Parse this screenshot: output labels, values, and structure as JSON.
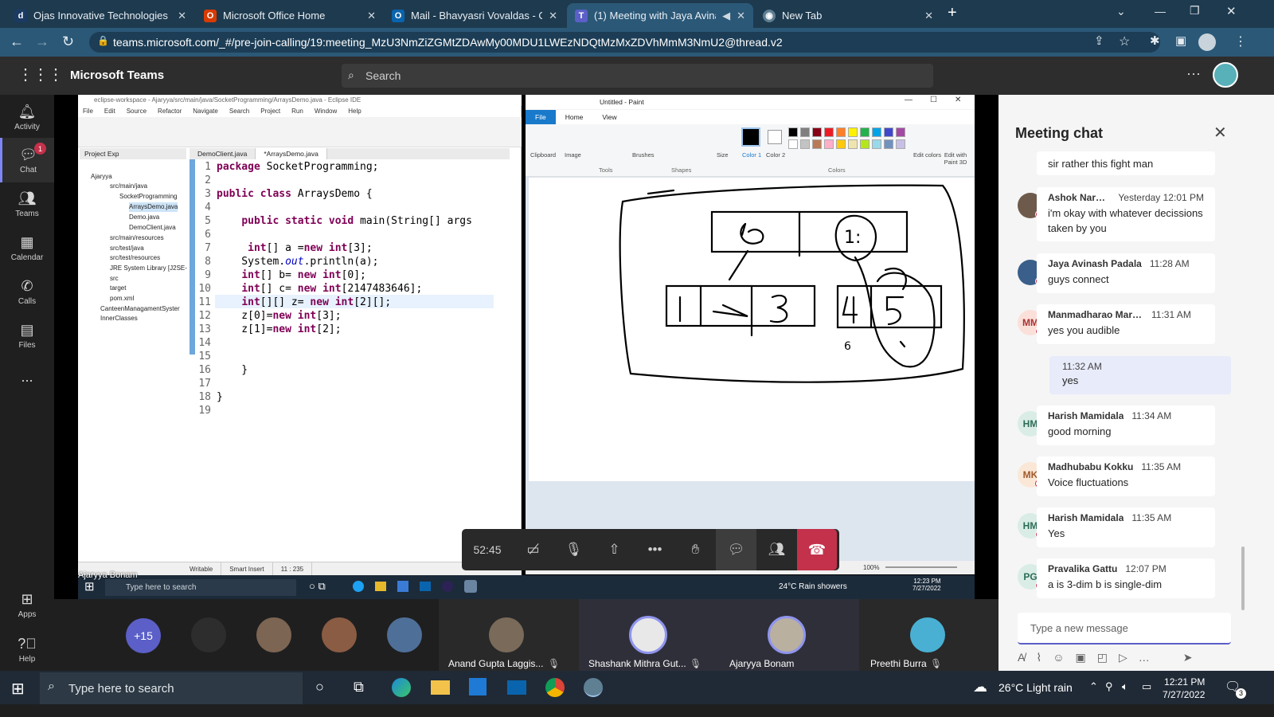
{
  "browser": {
    "tabs": [
      {
        "title": "Ojas Innovative Technologies : Lo",
        "icon": "d-icon"
      },
      {
        "title": "Microsoft Office Home",
        "icon": "office-icon"
      },
      {
        "title": "Mail - Bhavyasri Vovaldas - Outlo",
        "icon": "outlook-icon"
      },
      {
        "title": "(1) Meeting with Jaya Avinas",
        "icon": "teams-icon"
      },
      {
        "title": "New Tab",
        "icon": "chrome-icon"
      }
    ],
    "url": "teams.microsoft.com/_#/pre-join-calling/19:meeting_MzU3NmZiZGMtZDAwMy00MDU1LWEzNDQtMzMxZDVhMmM3NmU2@thread.v2"
  },
  "teams": {
    "title": "Microsoft Teams",
    "search_placeholder": "Search",
    "rail": [
      {
        "label": "Activity",
        "icon": "bell-icon"
      },
      {
        "label": "Chat",
        "icon": "chat-icon",
        "badge": "1"
      },
      {
        "label": "Teams",
        "icon": "teams-icon"
      },
      {
        "label": "Calendar",
        "icon": "calendar-icon"
      },
      {
        "label": "Calls",
        "icon": "phone-icon"
      },
      {
        "label": "Files",
        "icon": "file-icon"
      },
      {
        "label": "...",
        "icon": "more-icon"
      },
      {
        "label": "Apps",
        "icon": "apps-icon"
      },
      {
        "label": "Help",
        "icon": "help-icon"
      }
    ]
  },
  "eclipse": {
    "title": "eclipse-workspace - Ajaryya/src/main/java/SocketProgramming/ArraysDemo.java - Eclipse IDE",
    "menu": [
      "File",
      "Edit",
      "Source",
      "Refactor",
      "Navigate",
      "Search",
      "Project",
      "Run",
      "Window",
      "Help"
    ],
    "panel_tab": "Project Exp",
    "tree": [
      "Ajaryya",
      "src/main/java",
      "SocketProgramming",
      "ArraysDemo.java",
      "Demo.java",
      "DemoClient.java",
      "src/main/resources",
      "src/test/java",
      "src/test/resources",
      "JRE System Library [J2SE-",
      "src",
      "target",
      "pom.xml",
      "CanteenManagamentSyster",
      "InnerClasses"
    ],
    "editor_tabs": [
      "DemoClient.java",
      "*ArraysDemo.java"
    ],
    "line_numbers": [
      "1",
      "2",
      "3",
      "4",
      "5",
      "6",
      "7",
      "8",
      "9",
      "10",
      "11",
      "12",
      "13",
      "14",
      "15",
      "16",
      "17",
      "18",
      "19"
    ],
    "code_lines": [
      "package SocketProgramming;",
      "",
      "public class ArraysDemo {",
      "",
      "    public static void main(String[] args",
      "",
      "     int[] a =new int[3];",
      "    System.out.println(a);",
      "    int[] b= new int[0];",
      "    int[] c= new int[2147483646];",
      "    int[][] z= new int[2][];",
      "    z[0]=new int[3];",
      "    z[1]=new int[2];",
      "",
      "",
      "    }",
      "",
      "}",
      ""
    ],
    "status": [
      "Writable",
      "Smart Insert",
      "11 : 235"
    ]
  },
  "paint": {
    "title": "Untitled - Paint",
    "tabs": [
      "File",
      "Home",
      "View"
    ],
    "groups": [
      "Clipboard",
      "Image",
      "Tools",
      "Brushes",
      "Shapes",
      "Size",
      "Color 1",
      "Color 2",
      "Colors",
      "Edit colors",
      "Edit with Paint 3D"
    ],
    "zoom": "100%",
    "palette": [
      "#000000",
      "#7f7f7f",
      "#880015",
      "#ed1c24",
      "#ff7f27",
      "#fff200",
      "#22b14c",
      "#00a2e8",
      "#3f48cc",
      "#a349a4",
      "#ffffff",
      "#c3c3c3",
      "#b97a57",
      "#ffaec9",
      "#ffc90e",
      "#efe4b0",
      "#b5e61d",
      "#99d9ea",
      "#7092be",
      "#c8bfe7"
    ]
  },
  "shared_taskbar": {
    "search": "Type here to search",
    "weather": "24°C  Rain showers",
    "time": "12:23 PM",
    "date": "7/27/2022",
    "presenter": "Ajaryya Bonam"
  },
  "call": {
    "timer": "52:45",
    "controls": [
      "camera-off-icon",
      "mic-off-icon",
      "share-icon",
      "more-icon",
      "raise-hand-icon",
      "chat-icon",
      "people-icon",
      "hangup-icon"
    ]
  },
  "participants": {
    "overflow": "+15",
    "named": [
      "Anand Gupta Laggis...",
      "Shashank Mithra Gut...",
      "Ajaryya Bonam",
      "Preethi Burra"
    ]
  },
  "chat": {
    "title": "Meeting chat",
    "messages": [
      {
        "author": "",
        "time": "",
        "text": "sir rather this fight man",
        "initials": ""
      },
      {
        "author": "Ashok Naram...",
        "time": "Yesterday 12:01 PM",
        "text": "i'm okay with whatever decissions taken by you",
        "initials": ""
      },
      {
        "author": "Jaya Avinash Padala",
        "time": "11:28 AM",
        "text": "guys connect",
        "initials": ""
      },
      {
        "author": "Manmadharao Maruva...",
        "time": "11:31 AM",
        "text": "yes you audible",
        "initials": "MM"
      },
      {
        "author": "Harish Mamidala",
        "time": "11:34 AM",
        "text": "good morning",
        "initials": "HM"
      },
      {
        "author": "Madhubabu Kokku",
        "time": "11:35 AM",
        "text": "Voice fluctuations",
        "initials": "MK"
      },
      {
        "author": "Harish Mamidala",
        "time": "11:35 AM",
        "text": "Yes",
        "initials": "HM"
      },
      {
        "author": "Pravalika Gattu",
        "time": "12:07 PM",
        "text": "a is 3-dim b is single-dim",
        "initials": "PG"
      }
    ],
    "self_message": {
      "time": "11:32 AM",
      "text": "yes"
    },
    "compose_placeholder": "Type a new message"
  },
  "taskbar": {
    "search": "Type here to search",
    "weather": "26°C  Light rain",
    "time": "12:21 PM",
    "date": "7/27/2022",
    "notifications": "3"
  }
}
